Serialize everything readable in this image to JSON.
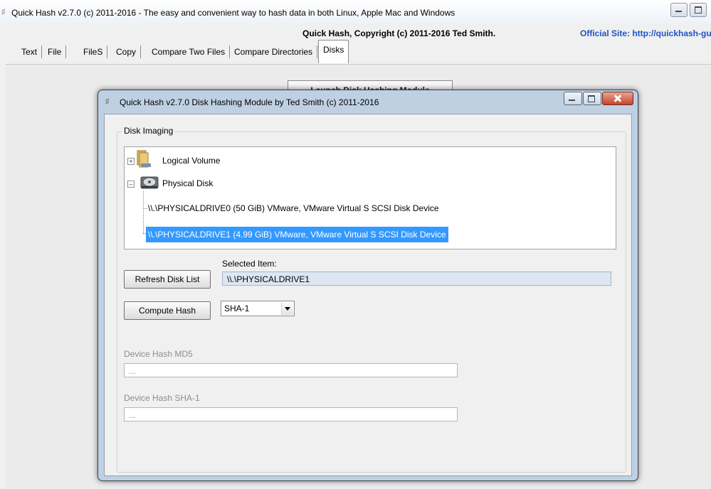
{
  "main_window": {
    "title": "Quick Hash v2.7.0 (c) 2011-2016 - The easy and convenient way to hash data in both Linux, Apple Mac and Windows",
    "copyright": "Quick Hash, Copyright (c) 2011-2016  Ted Smith.",
    "official_site": "Official Site: http://quickhash-gui"
  },
  "tabs": [
    {
      "label": "Text"
    },
    {
      "label": "File"
    },
    {
      "label": "FileS"
    },
    {
      "label": "Copy"
    },
    {
      "label": "Compare Two Files"
    },
    {
      "label": "Compare Directories"
    },
    {
      "label": "Disks"
    }
  ],
  "launch_button_label": "Launch Disk Hashing Module",
  "dialog": {
    "title": "Quick Hash v2.7.0 Disk Hashing Module by Ted Smith (c) 2011-2016",
    "group_label": "Disk Imaging",
    "tree": {
      "logical_volume": "Logical Volume",
      "physical_disk": "Physical Disk",
      "drive0": "\\\\.\\PHYSICALDRIVE0 (50 GiB) VMware, VMware Virtual S SCSI Disk Device",
      "drive1": "\\\\.\\PHYSICALDRIVE1 (4.99 GiB) VMware, VMware Virtual S SCSI Disk Device"
    },
    "selected_item_label": "Selected Item:",
    "selected_item_value": "\\\\.\\PHYSICALDRIVE1",
    "refresh_button": "Refresh Disk List",
    "compute_button": "Compute Hash",
    "algorithm": "SHA-1",
    "md5_label": "Device Hash MD5",
    "md5_value": "...",
    "sha1_label": "Device Hash SHA-1",
    "sha1_value": "..."
  }
}
